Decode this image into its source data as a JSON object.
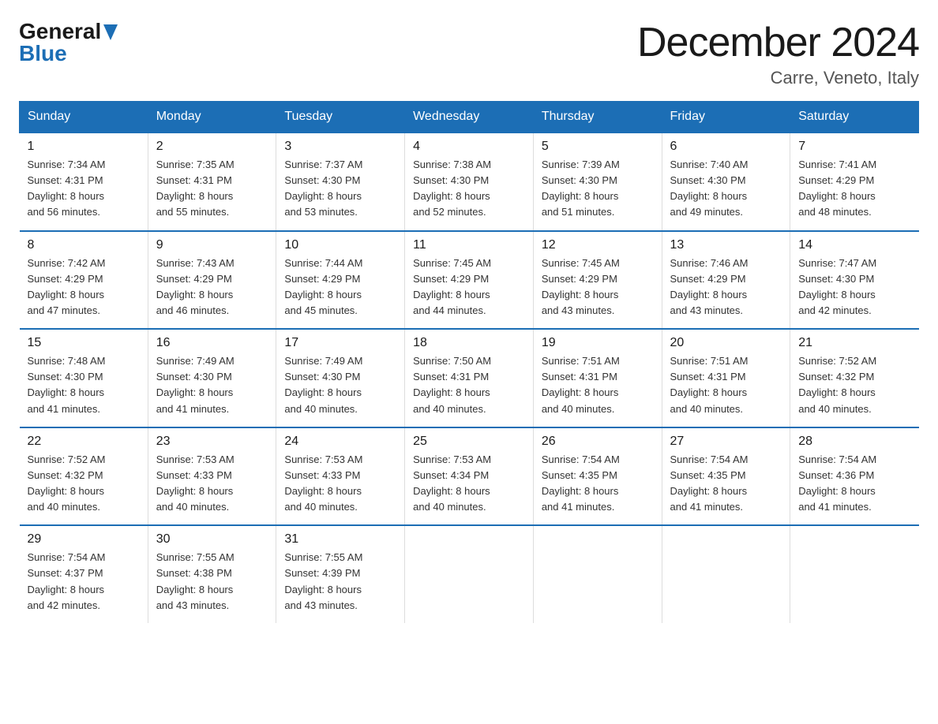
{
  "header": {
    "logo_general": "General",
    "logo_blue": "Blue",
    "month_title": "December 2024",
    "location": "Carre, Veneto, Italy"
  },
  "days_of_week": [
    "Sunday",
    "Monday",
    "Tuesday",
    "Wednesday",
    "Thursday",
    "Friday",
    "Saturday"
  ],
  "weeks": [
    [
      {
        "day": "1",
        "sunrise": "7:34 AM",
        "sunset": "4:31 PM",
        "daylight": "8 hours and 56 minutes."
      },
      {
        "day": "2",
        "sunrise": "7:35 AM",
        "sunset": "4:31 PM",
        "daylight": "8 hours and 55 minutes."
      },
      {
        "day": "3",
        "sunrise": "7:37 AM",
        "sunset": "4:30 PM",
        "daylight": "8 hours and 53 minutes."
      },
      {
        "day": "4",
        "sunrise": "7:38 AM",
        "sunset": "4:30 PM",
        "daylight": "8 hours and 52 minutes."
      },
      {
        "day": "5",
        "sunrise": "7:39 AM",
        "sunset": "4:30 PM",
        "daylight": "8 hours and 51 minutes."
      },
      {
        "day": "6",
        "sunrise": "7:40 AM",
        "sunset": "4:30 PM",
        "daylight": "8 hours and 49 minutes."
      },
      {
        "day": "7",
        "sunrise": "7:41 AM",
        "sunset": "4:29 PM",
        "daylight": "8 hours and 48 minutes."
      }
    ],
    [
      {
        "day": "8",
        "sunrise": "7:42 AM",
        "sunset": "4:29 PM",
        "daylight": "8 hours and 47 minutes."
      },
      {
        "day": "9",
        "sunrise": "7:43 AM",
        "sunset": "4:29 PM",
        "daylight": "8 hours and 46 minutes."
      },
      {
        "day": "10",
        "sunrise": "7:44 AM",
        "sunset": "4:29 PM",
        "daylight": "8 hours and 45 minutes."
      },
      {
        "day": "11",
        "sunrise": "7:45 AM",
        "sunset": "4:29 PM",
        "daylight": "8 hours and 44 minutes."
      },
      {
        "day": "12",
        "sunrise": "7:45 AM",
        "sunset": "4:29 PM",
        "daylight": "8 hours and 43 minutes."
      },
      {
        "day": "13",
        "sunrise": "7:46 AM",
        "sunset": "4:29 PM",
        "daylight": "8 hours and 43 minutes."
      },
      {
        "day": "14",
        "sunrise": "7:47 AM",
        "sunset": "4:30 PM",
        "daylight": "8 hours and 42 minutes."
      }
    ],
    [
      {
        "day": "15",
        "sunrise": "7:48 AM",
        "sunset": "4:30 PM",
        "daylight": "8 hours and 41 minutes."
      },
      {
        "day": "16",
        "sunrise": "7:49 AM",
        "sunset": "4:30 PM",
        "daylight": "8 hours and 41 minutes."
      },
      {
        "day": "17",
        "sunrise": "7:49 AM",
        "sunset": "4:30 PM",
        "daylight": "8 hours and 40 minutes."
      },
      {
        "day": "18",
        "sunrise": "7:50 AM",
        "sunset": "4:31 PM",
        "daylight": "8 hours and 40 minutes."
      },
      {
        "day": "19",
        "sunrise": "7:51 AM",
        "sunset": "4:31 PM",
        "daylight": "8 hours and 40 minutes."
      },
      {
        "day": "20",
        "sunrise": "7:51 AM",
        "sunset": "4:31 PM",
        "daylight": "8 hours and 40 minutes."
      },
      {
        "day": "21",
        "sunrise": "7:52 AM",
        "sunset": "4:32 PM",
        "daylight": "8 hours and 40 minutes."
      }
    ],
    [
      {
        "day": "22",
        "sunrise": "7:52 AM",
        "sunset": "4:32 PM",
        "daylight": "8 hours and 40 minutes."
      },
      {
        "day": "23",
        "sunrise": "7:53 AM",
        "sunset": "4:33 PM",
        "daylight": "8 hours and 40 minutes."
      },
      {
        "day": "24",
        "sunrise": "7:53 AM",
        "sunset": "4:33 PM",
        "daylight": "8 hours and 40 minutes."
      },
      {
        "day": "25",
        "sunrise": "7:53 AM",
        "sunset": "4:34 PM",
        "daylight": "8 hours and 40 minutes."
      },
      {
        "day": "26",
        "sunrise": "7:54 AM",
        "sunset": "4:35 PM",
        "daylight": "8 hours and 41 minutes."
      },
      {
        "day": "27",
        "sunrise": "7:54 AM",
        "sunset": "4:35 PM",
        "daylight": "8 hours and 41 minutes."
      },
      {
        "day": "28",
        "sunrise": "7:54 AM",
        "sunset": "4:36 PM",
        "daylight": "8 hours and 41 minutes."
      }
    ],
    [
      {
        "day": "29",
        "sunrise": "7:54 AM",
        "sunset": "4:37 PM",
        "daylight": "8 hours and 42 minutes."
      },
      {
        "day": "30",
        "sunrise": "7:55 AM",
        "sunset": "4:38 PM",
        "daylight": "8 hours and 43 minutes."
      },
      {
        "day": "31",
        "sunrise": "7:55 AM",
        "sunset": "4:39 PM",
        "daylight": "8 hours and 43 minutes."
      },
      null,
      null,
      null,
      null
    ]
  ],
  "labels": {
    "sunrise": "Sunrise:",
    "sunset": "Sunset:",
    "daylight": "Daylight:"
  }
}
